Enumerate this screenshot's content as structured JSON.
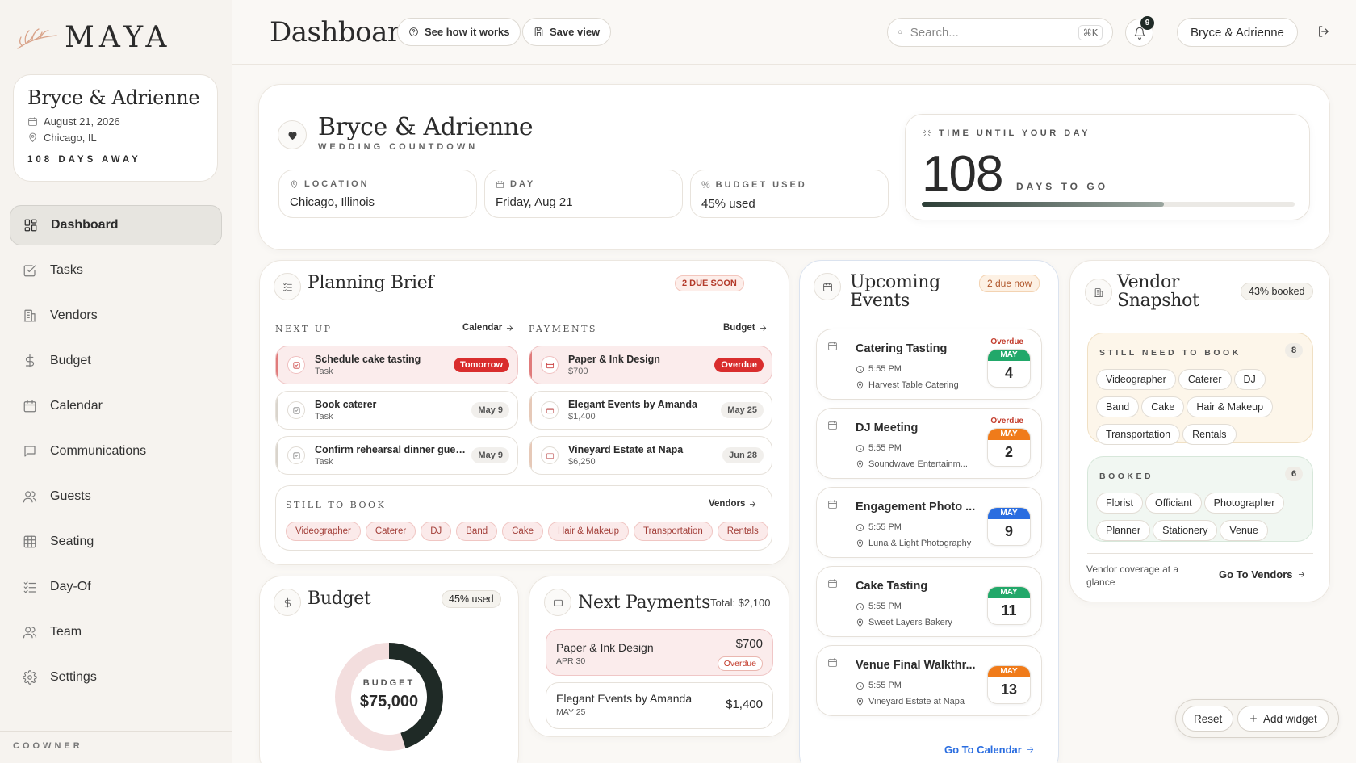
{
  "sidebar": {
    "logo": "MAYA",
    "couple": {
      "name": "Bryce & Adrienne",
      "date": "August 21, 2026",
      "location": "Chicago, IL",
      "away": "108 DAYS AWAY"
    },
    "nav": [
      {
        "label": "Dashboard",
        "icon": "grid-icon",
        "active": true
      },
      {
        "label": "Tasks",
        "icon": "checkbox-icon"
      },
      {
        "label": "Vendors",
        "icon": "building-icon"
      },
      {
        "label": "Budget",
        "icon": "dollar-icon"
      },
      {
        "label": "Calendar",
        "icon": "calendar-icon"
      },
      {
        "label": "Communications",
        "icon": "message-icon"
      },
      {
        "label": "Guests",
        "icon": "users-icon"
      },
      {
        "label": "Seating",
        "icon": "table-icon"
      },
      {
        "label": "Day-Of",
        "icon": "list-check-icon"
      },
      {
        "label": "Team",
        "icon": "team-icon"
      },
      {
        "label": "Settings",
        "icon": "gear-icon"
      }
    ],
    "footer": "COOWNER"
  },
  "topbar": {
    "title": "Dashboard",
    "how_label": "See how it works",
    "save_label": "Save view",
    "search_placeholder": "Search...",
    "search_shortcut": "⌘K",
    "notif_count": "9",
    "user": "Bryce & Adrienne"
  },
  "hero": {
    "title": "Bryce & Adrienne",
    "subtitle": "WEDDING COUNTDOWN",
    "location_label": "LOCATION",
    "location_value": "Chicago, Illinois",
    "day_label": "DAY",
    "day_value": "Friday, Aug 21",
    "budget_label": "BUDGET USED",
    "budget_value": "45% used",
    "countdown_label": "TIME UNTIL YOUR DAY",
    "countdown_days": "108",
    "countdown_unit": "DAYS TO GO",
    "progress": 0.65
  },
  "planning": {
    "title": "Planning Brief",
    "badge": "2 DUE SOON",
    "next_label": "NEXT UP",
    "next_link": "Calendar",
    "pay_label": "PAYMENTS",
    "pay_link": "Budget",
    "tasks": [
      {
        "title": "Schedule cake tasting",
        "sub": "Task",
        "tag": "Tomorrow",
        "urgent": true
      },
      {
        "title": "Book caterer",
        "sub": "Task",
        "tag": "May 9",
        "urgent": false
      },
      {
        "title": "Confirm rehearsal dinner guest...",
        "sub": "Task",
        "tag": "May 9",
        "urgent": false
      }
    ],
    "payments": [
      {
        "title": "Paper & Ink Design",
        "sub": "$700",
        "tag": "Overdue",
        "urgent": true
      },
      {
        "title": "Elegant Events by Amanda",
        "sub": "$1,400",
        "tag": "May 25",
        "urgent": false
      },
      {
        "title": "Vineyard Estate at Napa",
        "sub": "$6,250",
        "tag": "Jun 28",
        "urgent": false
      }
    ],
    "still_label": "STILL TO BOOK",
    "still_link": "Vendors",
    "still_items": [
      "Videographer",
      "Caterer",
      "DJ",
      "Band",
      "Cake",
      "Hair & Makeup",
      "Transportation",
      "Rentals"
    ]
  },
  "events": {
    "title_line1": "Upcoming",
    "title_line2": "Events",
    "badge": "2 due now",
    "items": [
      {
        "title": "Catering Tasting",
        "time": "5:55 PM",
        "place": "Harvest Table Catering",
        "overdue": "Overdue",
        "month": "MAY",
        "day": "4",
        "color": "#22a86a"
      },
      {
        "title": "DJ Meeting",
        "time": "5:55 PM",
        "place": "Soundwave Entertainm...",
        "overdue": "Overdue",
        "month": "MAY",
        "day": "2",
        "color": "#f07b1a"
      },
      {
        "title": "Engagement Photo ...",
        "time": "5:55 PM",
        "place": "Luna & Light Photography",
        "overdue": "",
        "month": "MAY",
        "day": "9",
        "color": "#2a6de0"
      },
      {
        "title": "Cake Tasting",
        "time": "5:55 PM",
        "place": "Sweet Layers Bakery",
        "overdue": "",
        "month": "MAY",
        "day": "11",
        "color": "#22a86a"
      },
      {
        "title": "Venue Final Walkthr...",
        "time": "5:55 PM",
        "place": "Vineyard Estate at Napa",
        "overdue": "",
        "month": "MAY",
        "day": "13",
        "color": "#f07b1a"
      }
    ],
    "link": "Go To Calendar"
  },
  "vendor": {
    "title_line1": "Vendor",
    "title_line2": "Snapshot",
    "badge": "43% booked",
    "need_label": "STILL NEED TO BOOK",
    "need_count": "8",
    "need_items": [
      "Videographer",
      "Caterer",
      "DJ",
      "Band",
      "Cake",
      "Hair & Makeup",
      "Transportation",
      "Rentals"
    ],
    "booked_label": "BOOKED",
    "booked_count": "6",
    "booked_items": [
      "Florist",
      "Officiant",
      "Photographer",
      "Planner",
      "Stationery",
      "Venue"
    ],
    "footer_text": "Vendor coverage at a glance",
    "footer_link": "Go To Vendors"
  },
  "budget": {
    "title": "Budget",
    "badge": "45% used",
    "donut_label": "BUDGET",
    "donut_value": "$75,000",
    "used_fraction": 0.45
  },
  "next_payments": {
    "title": "Next Payments",
    "total": "Total: $2,100",
    "items": [
      {
        "title": "Paper & Ink Design",
        "date": "APR 30",
        "amount": "$700",
        "tag": "Overdue",
        "urgent": true
      },
      {
        "title": "Elegant Events by Amanda",
        "date": "MAY 25",
        "amount": "$1,400",
        "tag": "",
        "urgent": false
      }
    ]
  },
  "widgets": {
    "reset": "Reset",
    "add": "Add widget"
  },
  "colors": {
    "accent": "#1f2a26",
    "danger": "#d92d2d",
    "donut_used": "#1f2a26",
    "donut_rest": "#f3dede"
  }
}
